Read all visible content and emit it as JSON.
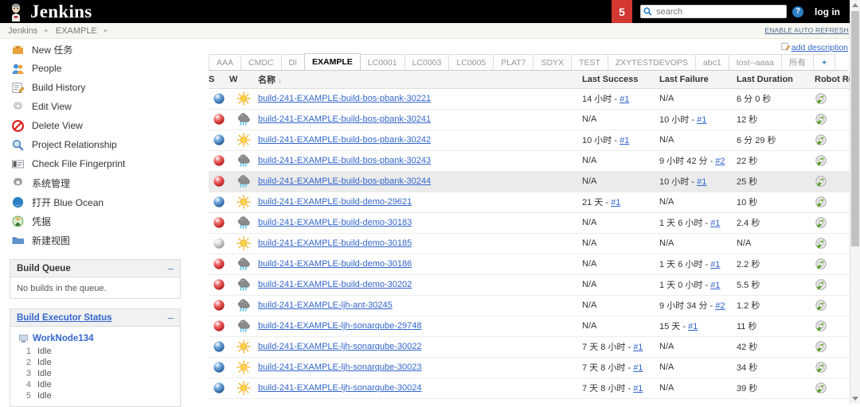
{
  "header": {
    "title": "Jenkins",
    "logo_icon": "butler-icon",
    "build_badge": "5",
    "search_placeholder": "search",
    "search_value": "",
    "search_icon": "search-icon",
    "help_icon": "help-icon",
    "help_glyph": "?",
    "login_label": "log in"
  },
  "breadcrumb": {
    "items": [
      "Jenkins",
      "EXAMPLE"
    ],
    "separator": "▸",
    "auto_refresh_label": "ENABLE AUTO REFRESH"
  },
  "sidebar": {
    "items": [
      {
        "label": "New 任务",
        "icon": "new-job-icon"
      },
      {
        "label": "People",
        "icon": "people-icon"
      },
      {
        "label": "Build History",
        "icon": "build-history-icon"
      },
      {
        "label": "Edit View",
        "icon": "edit-view-icon"
      },
      {
        "label": "Delete View",
        "icon": "delete-view-icon"
      },
      {
        "label": "Project Relationship",
        "icon": "project-relationship-icon"
      },
      {
        "label": "Check File Fingerprint",
        "icon": "fingerprint-icon"
      },
      {
        "label": "系统管理",
        "icon": "manage-jenkins-icon"
      },
      {
        "label": "打开 Blue Ocean",
        "icon": "blue-ocean-icon"
      },
      {
        "label": "凭据",
        "icon": "credentials-icon"
      },
      {
        "label": "新建视图",
        "icon": "new-view-icon"
      }
    ],
    "build_queue": {
      "title": "Build Queue",
      "collapse_glyph": "–",
      "empty_text": "No builds in the queue."
    },
    "build_executor": {
      "title": "Build Executor Status",
      "collapse_glyph": "–",
      "node_name": "WorkNode134",
      "node_icon": "computer-icon",
      "executors": [
        {
          "num": "1",
          "status": "Idle"
        },
        {
          "num": "2",
          "status": "Idle"
        },
        {
          "num": "3",
          "status": "Idle"
        },
        {
          "num": "4",
          "status": "Idle"
        },
        {
          "num": "5",
          "status": "Idle"
        }
      ]
    }
  },
  "main": {
    "add_description_label": "add description",
    "add_description_icon": "edit-note-icon",
    "tabs": [
      {
        "label": "AAA",
        "active": false
      },
      {
        "label": "CMDC",
        "active": false
      },
      {
        "label": "DI",
        "active": false
      },
      {
        "label": "EXAMPLE",
        "active": true
      },
      {
        "label": "LC0001",
        "active": false
      },
      {
        "label": "LC0003",
        "active": false
      },
      {
        "label": "LC0005",
        "active": false
      },
      {
        "label": "PLAT7",
        "active": false
      },
      {
        "label": "SDYX",
        "active": false
      },
      {
        "label": "TEST",
        "active": false
      },
      {
        "label": "ZXYTESTDEVOPS",
        "active": false
      },
      {
        "label": "abc1",
        "active": false
      },
      {
        "label": "tost--aaaa",
        "active": false
      },
      {
        "label": "所有",
        "active": false
      },
      {
        "label": "+",
        "active": false,
        "plus": true
      }
    ],
    "table": {
      "columns": [
        "S",
        "W",
        "名称",
        "Last Success",
        "Last Failure",
        "Last Duration",
        "Robot Results"
      ],
      "sort_indicator": "↓",
      "sorted_column": "名称",
      "rows": [
        {
          "status": "blue",
          "weather": "sunny",
          "name": "build-241-EXAMPLE-build-bos-pbank-30221",
          "last_success": "14 小时 - ",
          "last_success_build": "#1",
          "last_failure": "N/A",
          "last_failure_build": "",
          "last_duration": "6 分 0 秒",
          "robot": "robot-results-icon",
          "highlight": false
        },
        {
          "status": "red",
          "weather": "stormy",
          "name": "build-241-EXAMPLE-build-bos-pbank-30241",
          "last_success": "N/A",
          "last_success_build": "",
          "last_failure": "10 小时 - ",
          "last_failure_build": "#1",
          "last_duration": "12 秒",
          "robot": "robot-results-icon",
          "highlight": false
        },
        {
          "status": "blue",
          "weather": "sunny",
          "name": "build-241-EXAMPLE-build-bos-pbank-30242",
          "last_success": "10 小时 - ",
          "last_success_build": "#1",
          "last_failure": "N/A",
          "last_failure_build": "",
          "last_duration": "6 分 29 秒",
          "robot": "robot-results-icon",
          "highlight": false
        },
        {
          "status": "red",
          "weather": "stormy",
          "name": "build-241-EXAMPLE-build-bos-pbank-30243",
          "last_success": "N/A",
          "last_success_build": "",
          "last_failure": "9 小时 42 分 - ",
          "last_failure_build": "#2",
          "last_duration": "22 秒",
          "robot": "robot-results-icon",
          "highlight": false
        },
        {
          "status": "red",
          "weather": "stormy",
          "name": "build-241-EXAMPLE-build-bos-pbank-30244",
          "last_success": "N/A",
          "last_success_build": "",
          "last_failure": "10 小时 - ",
          "last_failure_build": "#1",
          "last_duration": "25 秒",
          "robot": "robot-results-icon",
          "highlight": true
        },
        {
          "status": "blue",
          "weather": "sunny",
          "name": "build-241-EXAMPLE-build-demo-29621",
          "last_success": "21 天 - ",
          "last_success_build": "#1",
          "last_failure": "N/A",
          "last_failure_build": "",
          "last_duration": "10 秒",
          "robot": "robot-results-icon",
          "highlight": false
        },
        {
          "status": "red",
          "weather": "stormy",
          "name": "build-241-EXAMPLE-build-demo-30183",
          "last_success": "N/A",
          "last_success_build": "",
          "last_failure": "1 天 6 小时 - ",
          "last_failure_build": "#1",
          "last_duration": "2.4 秒",
          "robot": "robot-results-icon",
          "highlight": false
        },
        {
          "status": "grey",
          "weather": "sunny",
          "name": "build-241-EXAMPLE-build-demo-30185",
          "last_success": "N/A",
          "last_success_build": "",
          "last_failure": "N/A",
          "last_failure_build": "",
          "last_duration": "N/A",
          "robot": "robot-results-icon",
          "highlight": false
        },
        {
          "status": "red",
          "weather": "stormy",
          "name": "build-241-EXAMPLE-build-demo-30186",
          "last_success": "N/A",
          "last_success_build": "",
          "last_failure": "1 天 6 小时 - ",
          "last_failure_build": "#1",
          "last_duration": "2.2 秒",
          "robot": "robot-results-icon",
          "highlight": false
        },
        {
          "status": "red",
          "weather": "stormy",
          "name": "build-241-EXAMPLE-build-demo-30202",
          "last_success": "N/A",
          "last_success_build": "",
          "last_failure": "1 天 0 小时 - ",
          "last_failure_build": "#1",
          "last_duration": "5.5 秒",
          "robot": "robot-results-icon",
          "highlight": false
        },
        {
          "status": "red",
          "weather": "stormy",
          "name": "build-241-EXAMPLE-ljh-ant-30245",
          "last_success": "N/A",
          "last_success_build": "",
          "last_failure": "9 小时 34 分 - ",
          "last_failure_build": "#2",
          "last_duration": "1.2 秒",
          "robot": "robot-results-icon",
          "highlight": false
        },
        {
          "status": "red",
          "weather": "stormy",
          "name": "build-241-EXAMPLE-ljh-sonarqube-29748",
          "last_success": "N/A",
          "last_success_build": "",
          "last_failure": "15 天 - ",
          "last_failure_build": "#1",
          "last_duration": "11 秒",
          "robot": "robot-results-icon",
          "highlight": false
        },
        {
          "status": "blue",
          "weather": "sunny",
          "name": "build-241-EXAMPLE-ljh-sonarqube-30022",
          "last_success": "7 天 8 小时 - ",
          "last_success_build": "#1",
          "last_failure": "N/A",
          "last_failure_build": "",
          "last_duration": "42 秒",
          "robot": "robot-results-icon",
          "highlight": false
        },
        {
          "status": "blue",
          "weather": "sunny",
          "name": "build-241-EXAMPLE-ljh-sonarqube-30023",
          "last_success": "7 天 8 小时 - ",
          "last_success_build": "#1",
          "last_failure": "N/A",
          "last_failure_build": "",
          "last_duration": "34 秒",
          "robot": "robot-results-icon",
          "highlight": false
        },
        {
          "status": "blue",
          "weather": "sunny",
          "name": "build-241-EXAMPLE-ljh-sonarqube-30024",
          "last_success": "7 天 8 小时 - ",
          "last_success_build": "#1",
          "last_failure": "N/A",
          "last_failure_build": "",
          "last_duration": "39 秒",
          "robot": "robot-results-icon",
          "highlight": false
        }
      ]
    }
  },
  "colors": {
    "brand_red": "#d33833",
    "link_blue": "#3366cc",
    "status_blue": "#3b78c3",
    "status_red": "#e03030",
    "status_grey": "#c4c4c4",
    "topbar_black": "#000000"
  }
}
